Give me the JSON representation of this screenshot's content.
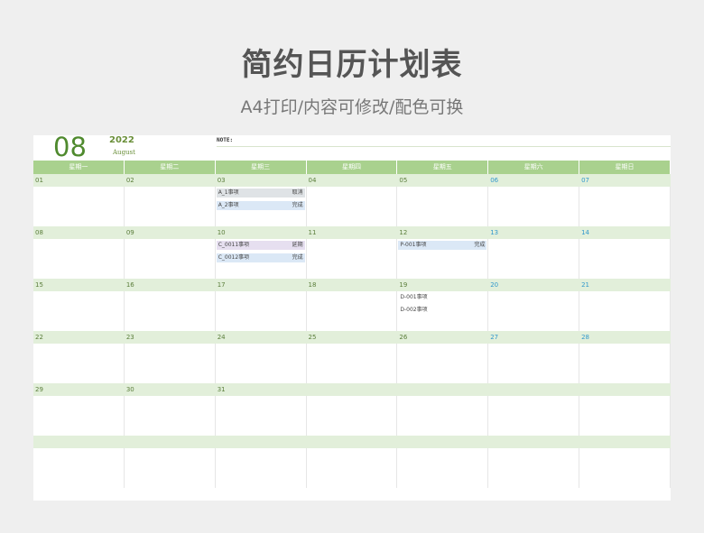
{
  "title": "简约日历计划表",
  "subtitle": "A4打印/内容可修改/配色可换",
  "header": {
    "month": "08",
    "year": "2022",
    "month_name": "August",
    "note_label": "NOTE:"
  },
  "weekdays": [
    "星期一",
    "星期二",
    "星期三",
    "星期四",
    "星期五",
    "星期六",
    "星期日"
  ],
  "weeks": [
    {
      "days": [
        "01",
        "02",
        "03",
        "04",
        "05",
        "06",
        "07"
      ]
    },
    {
      "days": [
        "08",
        "09",
        "10",
        "11",
        "12",
        "13",
        "14"
      ]
    },
    {
      "days": [
        "15",
        "16",
        "17",
        "18",
        "19",
        "20",
        "21"
      ]
    },
    {
      "days": [
        "22",
        "23",
        "24",
        "25",
        "26",
        "27",
        "28"
      ]
    },
    {
      "days": [
        "29",
        "30",
        "31",
        "",
        "",
        "",
        ""
      ]
    },
    {
      "days": [
        "",
        "",
        "",
        "",
        "",
        "",
        ""
      ]
    }
  ],
  "events": {
    "w0_d2_e0": {
      "name": "A_1事项",
      "status": "取消"
    },
    "w0_d2_e1": {
      "name": "A_2事项",
      "status": "完成"
    },
    "w1_d2_e0": {
      "name": "C_0011事项",
      "status": "延期"
    },
    "w1_d2_e1": {
      "name": "C_0012事项",
      "status": "完成"
    },
    "w1_d4_e0": {
      "name": "P-001事项",
      "status": "完成"
    },
    "w2_d4_e0": {
      "name": "D-001事项",
      "status": ""
    },
    "w2_d4_e1": {
      "name": "D-002事项",
      "status": ""
    }
  },
  "colors": {
    "accent": "#a9d18e",
    "strip": "#e2efda",
    "weekend": "#3399cc",
    "month": "#4f8a2e"
  }
}
